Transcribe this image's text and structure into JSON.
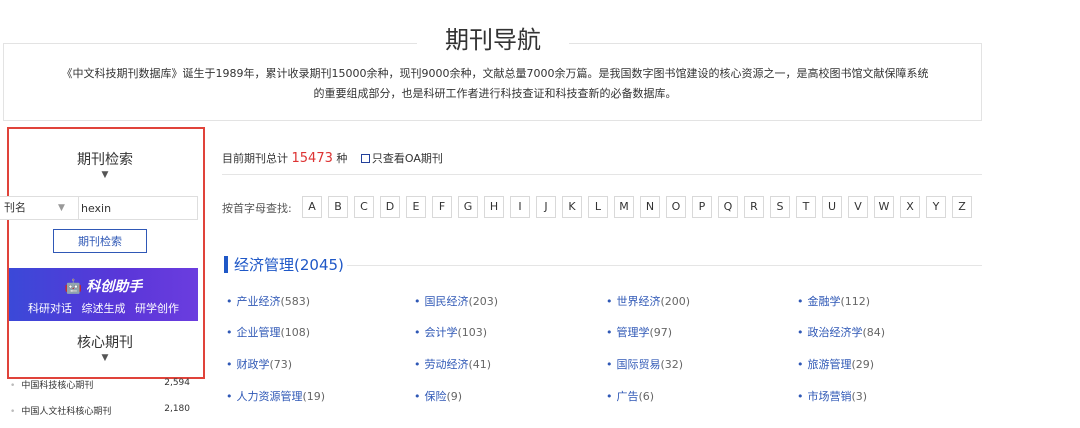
{
  "header": {
    "title": "期刊导航",
    "intro_line1": "《中文科技期刊数据库》诞生于1989年，累计收录期刊15000余种，现刊9000余种，文献总量7000余万篇。是我国数字图书馆建设的核心资源之一，是高校图书馆文献保障系统",
    "intro_line2": "的重要组成部分，也是科研工作者进行科技查证和科技查新的必备数据库。"
  },
  "sidebar": {
    "search_title": "期刊检索",
    "search_field": "刊名",
    "search_value": "hexin",
    "search_button": "期刊检索",
    "banner": {
      "title": "科创助手",
      "links": [
        "科研对话",
        "综述生成",
        "研学创作"
      ]
    },
    "core_title": "核心期刊",
    "core_list": [
      {
        "name": "中国科技核心期刊",
        "count": "2,594"
      },
      {
        "name": "中国人文社科核心期刊",
        "count": "2,180"
      }
    ]
  },
  "main": {
    "total_prefix": "目前期刊总计",
    "total_count": "15473",
    "total_suffix": "种",
    "oa_label": "只查看OA期刊",
    "letters_label": "按首字母查找:",
    "letters": [
      "A",
      "B",
      "C",
      "D",
      "E",
      "F",
      "G",
      "H",
      "I",
      "J",
      "K",
      "L",
      "M",
      "N",
      "O",
      "P",
      "Q",
      "R",
      "S",
      "T",
      "U",
      "V",
      "W",
      "X",
      "Y",
      "Z"
    ],
    "category": {
      "title": "经济管理(2045)",
      "items": [
        {
          "name": "产业经济",
          "count": "(583)"
        },
        {
          "name": "国民经济",
          "count": "(203)"
        },
        {
          "name": "世界经济",
          "count": "(200)"
        },
        {
          "name": "金融学",
          "count": "(112)"
        },
        {
          "name": "企业管理",
          "count": "(108)"
        },
        {
          "name": "会计学",
          "count": "(103)"
        },
        {
          "name": "管理学",
          "count": "(97)"
        },
        {
          "name": "政治经济学",
          "count": "(84)"
        },
        {
          "name": "财政学",
          "count": "(73)"
        },
        {
          "name": "劳动经济",
          "count": "(41)"
        },
        {
          "name": "国际贸易",
          "count": "(32)"
        },
        {
          "name": "旅游管理",
          "count": "(29)"
        },
        {
          "name": "人力资源管理",
          "count": "(19)"
        },
        {
          "name": "保险",
          "count": "(9)"
        },
        {
          "name": "广告",
          "count": "(6)"
        },
        {
          "name": "市场营销",
          "count": "(3)"
        }
      ]
    }
  },
  "colors": {
    "accent": "#1f58c7",
    "highlight_border": "#e0433a",
    "count_red": "#d33333"
  }
}
